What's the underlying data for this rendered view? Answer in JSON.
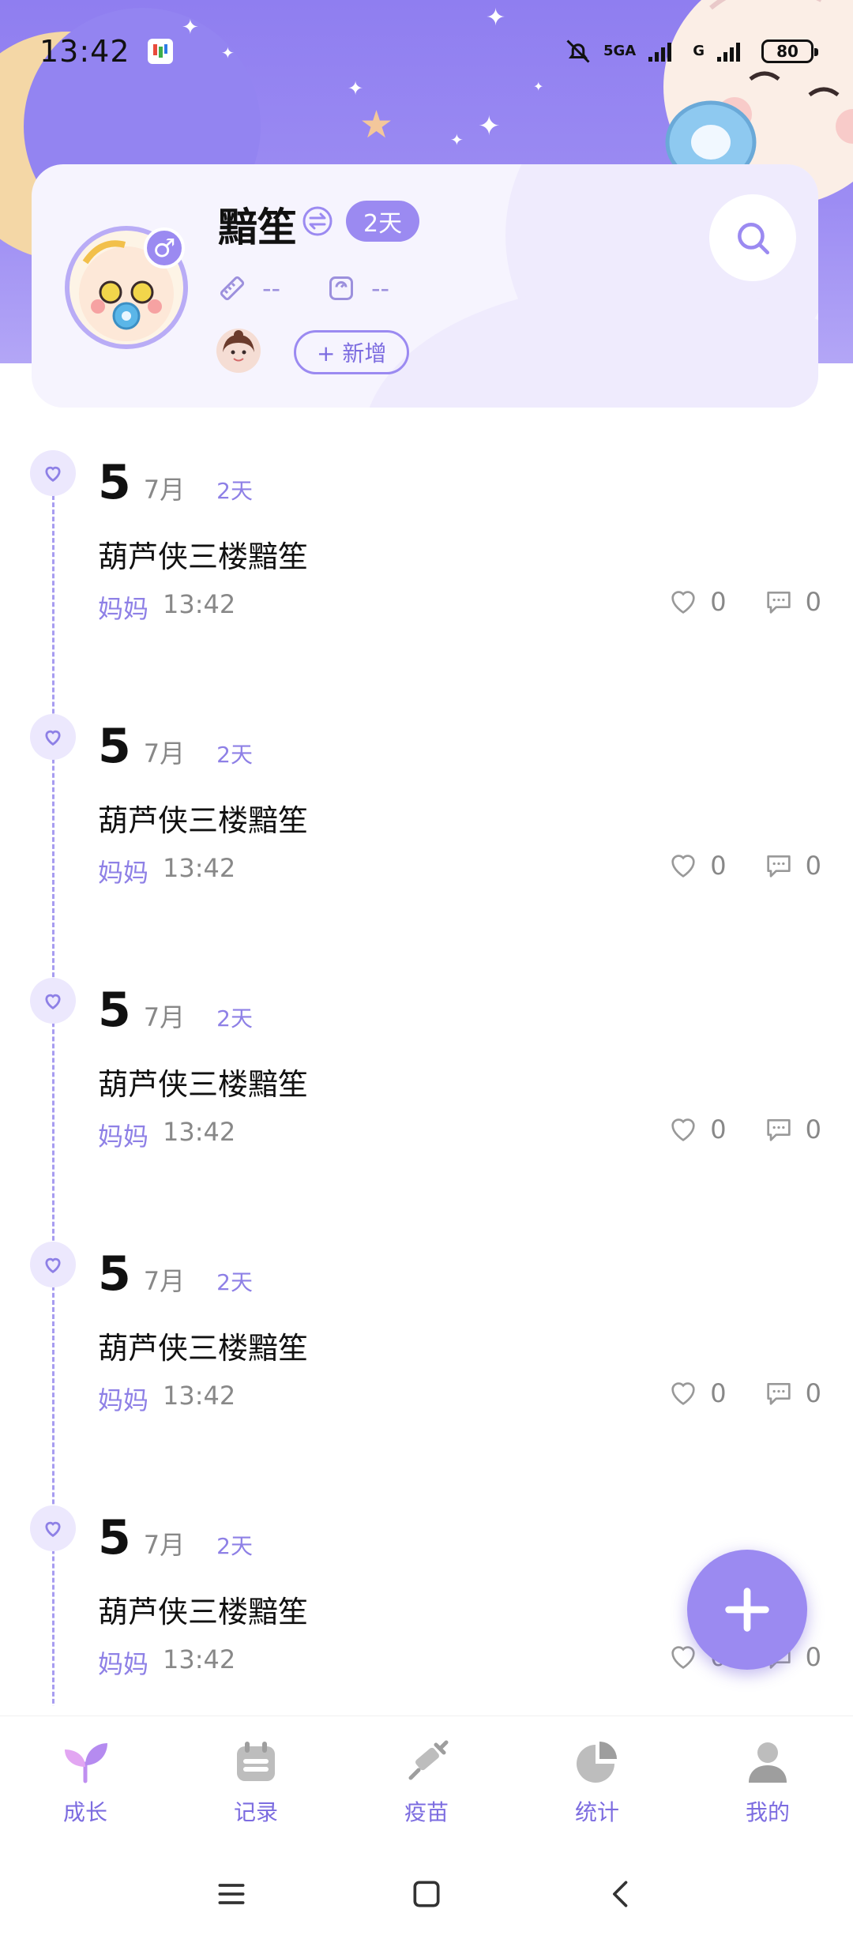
{
  "status_bar": {
    "time": "13:42",
    "network": "5GA",
    "network2": "G",
    "battery": "80"
  },
  "profile": {
    "baby_name": "黯笙",
    "age_badge": "2天",
    "height_value": "--",
    "weight_value": "--",
    "add_member_label": "+ 新增"
  },
  "timeline": {
    "entries": [
      {
        "day": "5",
        "month": "7月",
        "age": "2天",
        "text": "葫芦侠三楼黯笙",
        "author": "妈妈",
        "time": "13:42",
        "likes": "0",
        "comments": "0"
      },
      {
        "day": "5",
        "month": "7月",
        "age": "2天",
        "text": "葫芦侠三楼黯笙",
        "author": "妈妈",
        "time": "13:42",
        "likes": "0",
        "comments": "0"
      },
      {
        "day": "5",
        "month": "7月",
        "age": "2天",
        "text": "葫芦侠三楼黯笙",
        "author": "妈妈",
        "time": "13:42",
        "likes": "0",
        "comments": "0"
      },
      {
        "day": "5",
        "month": "7月",
        "age": "2天",
        "text": "葫芦侠三楼黯笙",
        "author": "妈妈",
        "time": "13:42",
        "likes": "0",
        "comments": "0"
      },
      {
        "day": "5",
        "month": "7月",
        "age": "2天",
        "text": "葫芦侠三楼黯笙",
        "author": "妈妈",
        "time": "13:42",
        "likes": "0",
        "comments": "0"
      }
    ]
  },
  "bottom_nav": {
    "items": [
      {
        "label": "成长",
        "icon": "sprout-icon",
        "active": true
      },
      {
        "label": "记录",
        "icon": "calendar-icon",
        "active": false
      },
      {
        "label": "疫苗",
        "icon": "syringe-icon",
        "active": false
      },
      {
        "label": "统计",
        "icon": "pie-chart-icon",
        "active": false
      },
      {
        "label": "我的",
        "icon": "user-icon",
        "active": false
      }
    ]
  },
  "colors": {
    "accent": "#9b8af1",
    "accent_text": "#7c6ce0",
    "inactive": "#b5b5b5"
  }
}
